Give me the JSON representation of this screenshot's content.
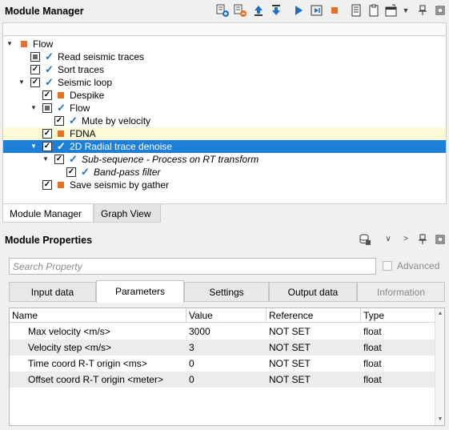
{
  "module_manager": {
    "title": "Module Manager",
    "toolbar_icons": [
      "add-module-icon",
      "remove-module-icon",
      "move-up-icon",
      "move-down-icon",
      "run-icon",
      "run-step-icon",
      "stop-icon",
      "list-icon",
      "clipboard-icon",
      "dropdown-toolbar-icon",
      "pin-icon",
      "float-icon"
    ],
    "tree": [
      {
        "label": "Flow",
        "level": 0,
        "expanded": true,
        "checkbox": "none",
        "marker": "square"
      },
      {
        "label": "Read seismic traces",
        "level": 1,
        "expanded": null,
        "checkbox": "partial",
        "marker": "tick"
      },
      {
        "label": "Sort traces",
        "level": 1,
        "expanded": null,
        "checkbox": "checked",
        "marker": "tick"
      },
      {
        "label": "Seismic loop",
        "level": 1,
        "expanded": true,
        "checkbox": "checked",
        "marker": "tick"
      },
      {
        "label": "Despike",
        "level": 2,
        "expanded": null,
        "checkbox": "checked",
        "marker": "square"
      },
      {
        "label": "Flow",
        "level": 2,
        "expanded": true,
        "checkbox": "partial",
        "marker": "tick"
      },
      {
        "label": "Mute by velocity",
        "level": 3,
        "expanded": null,
        "checkbox": "checked",
        "marker": "tick"
      },
      {
        "label": "FDNA",
        "level": 2,
        "expanded": null,
        "checkbox": "checked",
        "marker": "square"
      },
      {
        "label": "2D Radial trace denoise",
        "level": 2,
        "expanded": true,
        "checkbox": "checked",
        "marker": "tick"
      },
      {
        "label": "Sub-sequence - Process on RT transform",
        "level": 3,
        "expanded": true,
        "checkbox": "checked",
        "marker": "tick"
      },
      {
        "label": "Band-pass filter",
        "level": 4,
        "expanded": null,
        "checkbox": "checked",
        "marker": "tick"
      },
      {
        "label": "Save seismic by gather",
        "level": 2,
        "expanded": null,
        "checkbox": "checked",
        "marker": "square"
      }
    ],
    "bottom_tabs": [
      "Module Manager",
      "Graph View"
    ]
  },
  "module_properties": {
    "title": "Module Properties",
    "search_placeholder": "Search Property",
    "advanced_label": "Advanced",
    "tabs": [
      "Input data",
      "Parameters",
      "Settings",
      "Output data",
      "Information"
    ],
    "active_tab": "Parameters",
    "columns": [
      "Name",
      "Value",
      "Reference",
      "Type"
    ],
    "rows": [
      {
        "name": "Max velocity <m/s>",
        "value": "3000",
        "reference": "NOT SET",
        "type": "float"
      },
      {
        "name": "Velocity step <m/s>",
        "value": "3",
        "reference": "NOT SET",
        "type": "float"
      },
      {
        "name": "Time coord R-T origin <ms>",
        "value": "0",
        "reference": "NOT SET",
        "type": "float"
      },
      {
        "name": "Offset coord R-T origin <meter>",
        "value": "0",
        "reference": "NOT SET",
        "type": "float"
      }
    ]
  },
  "colors": {
    "selection": "#1e7fd8",
    "highlight_row": "#fcfbd6",
    "accent_orange": "#e8701e",
    "accent_blue": "#1d6fc4"
  }
}
